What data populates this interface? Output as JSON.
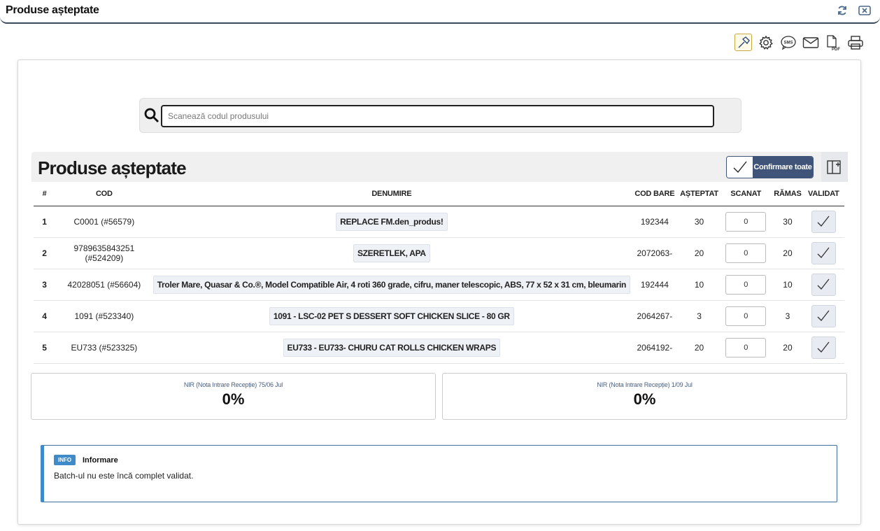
{
  "window": {
    "title": "Produse așteptate"
  },
  "search": {
    "placeholder": "Scanează codul produsului",
    "value": ""
  },
  "section": {
    "title": "Produse așteptate",
    "confirm_all_label": "Confirmare toate"
  },
  "table": {
    "headers": [
      "#",
      "COD",
      "DENUMIRE",
      "COD BARE",
      "AȘTEPTAT",
      "SCANAT",
      "RĂMAS",
      "VALIDAT"
    ],
    "rows": [
      {
        "num": "1",
        "cod": "C0001 (#56579)",
        "denumire": "REPLACE FM.den_produs!",
        "cod_bare": "192344",
        "asteptat": "30",
        "scanat": "0",
        "ramas": "30"
      },
      {
        "num": "2",
        "cod": "9789635843251 (#524209)",
        "denumire": "SZERETLEK, APA",
        "cod_bare": "2072063-",
        "asteptat": "20",
        "scanat": "0",
        "ramas": "20"
      },
      {
        "num": "3",
        "cod": "42028051 (#56604)",
        "denumire": "Troler Mare, Quasar & Co.®, Model Compatible Air, 4 roti 360 grade, cifru, maner telescopic, ABS, 77 x 52 x 31 cm, bleumarin",
        "cod_bare": "192444",
        "asteptat": "10",
        "scanat": "0",
        "ramas": "10"
      },
      {
        "num": "4",
        "cod": "1091 (#523340)",
        "denumire": "1091 - LSC-02 PET S DESSERT SOFT CHICKEN SLICE - 80 GR",
        "cod_bare": "2064267-",
        "asteptat": "3",
        "scanat": "0",
        "ramas": "3"
      },
      {
        "num": "5",
        "cod": "EU733 (#523325)",
        "denumire": "EU733 - EU733- CHURU CAT ROLLS CHICKEN WRAPS",
        "cod_bare": "2064192-",
        "asteptat": "20",
        "scanat": "0",
        "ramas": "20"
      }
    ]
  },
  "nir": [
    {
      "label": "NIR (Nota Intrare Recepție) 75/06 Jul",
      "value": "0%"
    },
    {
      "label": "NIR (Nota Intrare Recepție) 1/09 Jul",
      "value": "0%"
    }
  ],
  "info": {
    "badge": "INFO",
    "title": "Informare",
    "text": "Batch-ul nu este încă complet validat."
  },
  "toolbar": {
    "icons": [
      "hammer-icon",
      "gear-icon",
      "sms-icon",
      "mail-icon",
      "pdf-icon",
      "print-icon"
    ]
  },
  "colors": {
    "accent": "#3f5478",
    "info": "#3f8ac8",
    "nir_label": "#4a5f80"
  }
}
